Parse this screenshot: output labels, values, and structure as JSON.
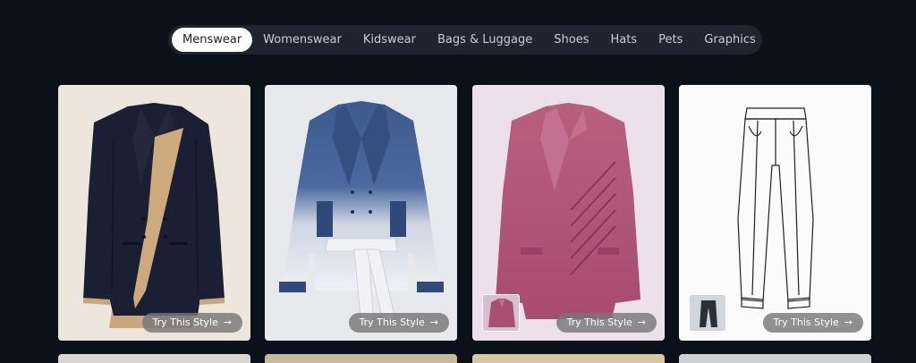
{
  "tabs": [
    {
      "label": "Menswear",
      "active": true
    },
    {
      "label": "Womenswear",
      "active": false
    },
    {
      "label": "Kidswear",
      "active": false
    },
    {
      "label": "Bags & Luggage",
      "active": false
    },
    {
      "label": "Shoes",
      "active": false
    },
    {
      "label": "Hats",
      "active": false
    },
    {
      "label": "Pets",
      "active": false
    },
    {
      "label": "Graphics",
      "active": false
    }
  ],
  "cards": [
    {
      "cta": "Try This Style",
      "arrow": "→",
      "image": "navy-beige-blazer",
      "bg": "#ece6dc"
    },
    {
      "cta": "Try This Style",
      "arrow": "→",
      "image": "denim-dip-dye-jacket",
      "bg": "#e8e9ec"
    },
    {
      "cta": "Try This Style",
      "arrow": "→",
      "image": "pink-corduroy-blazer",
      "bg": "#ece1eb",
      "thumb": "pink-blazer-thumbnail"
    },
    {
      "cta": "Try This Style",
      "arrow": "→",
      "image": "trousers-line-sketch",
      "bg": "#fbfbfc",
      "thumb": "black-trousers-thumbnail"
    }
  ],
  "colors": {
    "page_bg": "#0b1119",
    "tabbar_bg": "#1f2530",
    "active_tab": "#ffffff"
  }
}
